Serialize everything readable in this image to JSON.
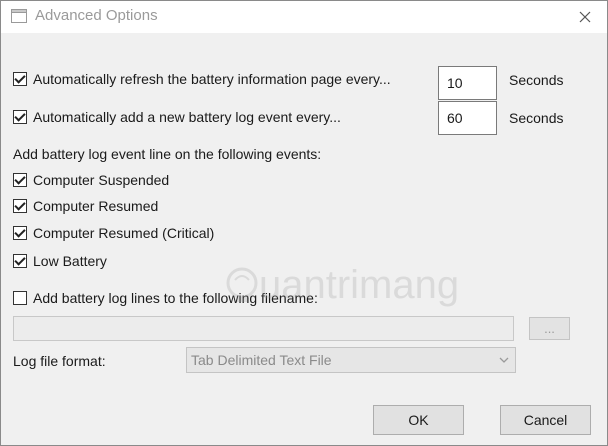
{
  "window": {
    "title": "Advanced Options"
  },
  "options": {
    "auto_refresh": {
      "checked": true,
      "label": "Automatically refresh the battery information page every...",
      "value": "10",
      "unit": "Seconds"
    },
    "auto_log": {
      "checked": true,
      "label": "Automatically add a new battery log  event every...",
      "value": "60",
      "unit": "Seconds"
    }
  },
  "events": {
    "heading": "Add battery log event line on the following events:",
    "items": [
      {
        "label": "Computer Suspended",
        "checked": true
      },
      {
        "label": "Computer Resumed",
        "checked": true
      },
      {
        "label": "Computer Resumed (Critical)",
        "checked": true
      },
      {
        "label": "Low Battery",
        "checked": true
      }
    ]
  },
  "filename": {
    "checked": false,
    "label": "Add battery log lines to the following filename:",
    "value": "",
    "browse_label": "..."
  },
  "log_format": {
    "label": "Log file format:",
    "selected": "Tab Delimited Text File"
  },
  "buttons": {
    "ok": "OK",
    "cancel": "Cancel"
  },
  "watermark": {
    "text": "uantrimang"
  },
  "icons": {
    "app": "window-icon",
    "close": "close-icon",
    "dropdown": "chevron-down-icon"
  }
}
